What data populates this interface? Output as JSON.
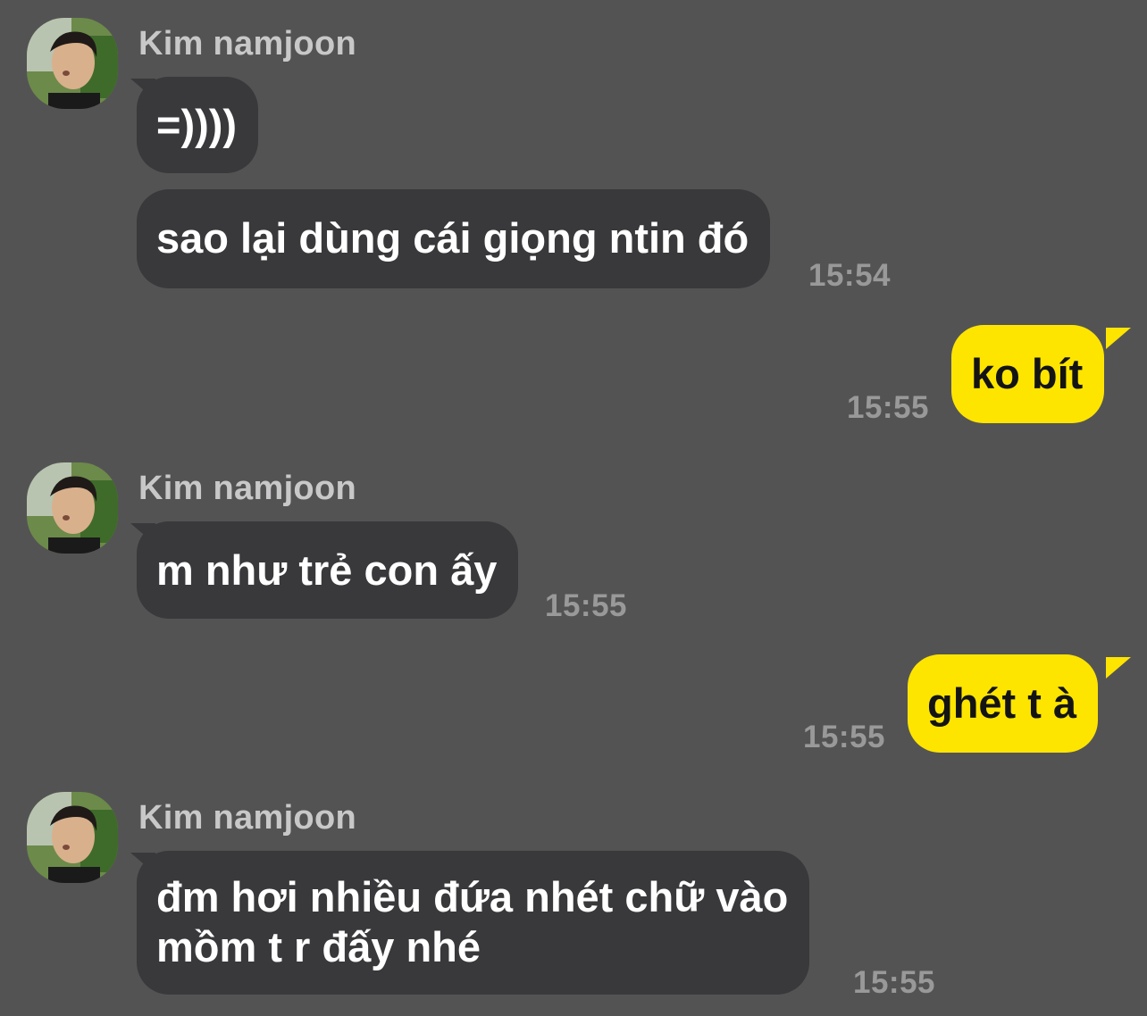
{
  "contact": {
    "name": "Kim namjoon",
    "avatar_icon": "profile-photo"
  },
  "messages": [
    {
      "from": "them",
      "text": "=))))"
    },
    {
      "from": "them",
      "text": "sao lại dùng cái giọng ntin đó",
      "time": "15:54"
    },
    {
      "from": "me",
      "text": "ko bít",
      "time": "15:55"
    },
    {
      "from": "them",
      "text": "m như trẻ con ấy",
      "time": "15:55"
    },
    {
      "from": "me",
      "text": "ghét t à",
      "time": "15:55"
    },
    {
      "from": "them",
      "lines": [
        "đm hơi nhiều đứa nhét chữ vào",
        "mồm t r đấy nhé"
      ],
      "time": "15:55"
    }
  ],
  "colors": {
    "background": "#545354",
    "incoming_bubble": "#39383a",
    "outgoing_bubble": "#fee500"
  }
}
